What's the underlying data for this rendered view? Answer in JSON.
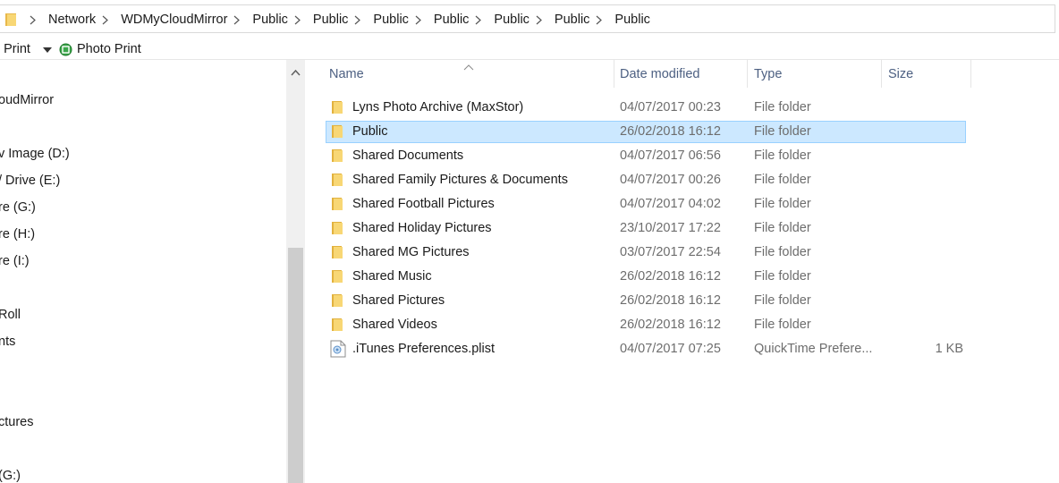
{
  "breadcrumbs": [
    "Network",
    "WDMyCloudMirror",
    "Public",
    "Public",
    "Public",
    "Public",
    "Public",
    "Public",
    "Public"
  ],
  "toolbar": {
    "print_label": "o Print",
    "photo_print_label": "Photo Print"
  },
  "nav": {
    "items": [
      {
        "label": "oudMirror"
      },
      {
        "label": "v Image (D:)"
      },
      {
        "label": "/ Drive (E:)"
      },
      {
        "label": "re (G:)"
      },
      {
        "label": "re (H:)"
      },
      {
        "label": "re (I:)"
      },
      {
        "label": "Roll"
      },
      {
        "label": "nts"
      },
      {
        "label": "ctures"
      },
      {
        "label": "(G:)"
      }
    ]
  },
  "columns": {
    "name": "Name",
    "date": "Date modified",
    "type": "Type",
    "size": "Size"
  },
  "files": [
    {
      "name": "Lyns Photo Archive (MaxStor)",
      "date": "04/07/2017 00:23",
      "type": "File folder",
      "size": "",
      "icon": "folder-icon",
      "selected": false
    },
    {
      "name": "Public",
      "date": "26/02/2018 16:12",
      "type": "File folder",
      "size": "",
      "icon": "folder-icon",
      "selected": true
    },
    {
      "name": "Shared Documents",
      "date": "04/07/2017 06:56",
      "type": "File folder",
      "size": "",
      "icon": "folder-icon",
      "selected": false
    },
    {
      "name": "Shared Family Pictures & Documents",
      "date": "04/07/2017 00:26",
      "type": "File folder",
      "size": "",
      "icon": "folder-icon",
      "selected": false
    },
    {
      "name": "Shared Football Pictures",
      "date": "04/07/2017 04:02",
      "type": "File folder",
      "size": "",
      "icon": "folder-icon",
      "selected": false
    },
    {
      "name": "Shared Holiday Pictures",
      "date": "23/10/2017 17:22",
      "type": "File folder",
      "size": "",
      "icon": "folder-icon",
      "selected": false
    },
    {
      "name": "Shared MG Pictures",
      "date": "03/07/2017 22:54",
      "type": "File folder",
      "size": "",
      "icon": "folder-icon",
      "selected": false
    },
    {
      "name": "Shared Music",
      "date": "26/02/2018 16:12",
      "type": "File folder",
      "size": "",
      "icon": "folder-icon",
      "selected": false
    },
    {
      "name": "Shared Pictures",
      "date": "26/02/2018 16:12",
      "type": "File folder",
      "size": "",
      "icon": "folder-icon",
      "selected": false
    },
    {
      "name": "Shared Videos",
      "date": "26/02/2018 16:12",
      "type": "File folder",
      "size": "",
      "icon": "folder-icon",
      "selected": false
    },
    {
      "name": ".iTunes Preferences.plist",
      "date": "04/07/2017 07:25",
      "type": "QuickTime Prefere...",
      "size": "1 KB",
      "icon": "plist-file-icon",
      "selected": false
    }
  ],
  "colors": {
    "selection_bg": "#cce8ff",
    "selection_border": "#99d1ff",
    "folder_yellow": "#f8d775",
    "header_text": "#4d6082",
    "secondary_text": "#6d6d6d"
  }
}
